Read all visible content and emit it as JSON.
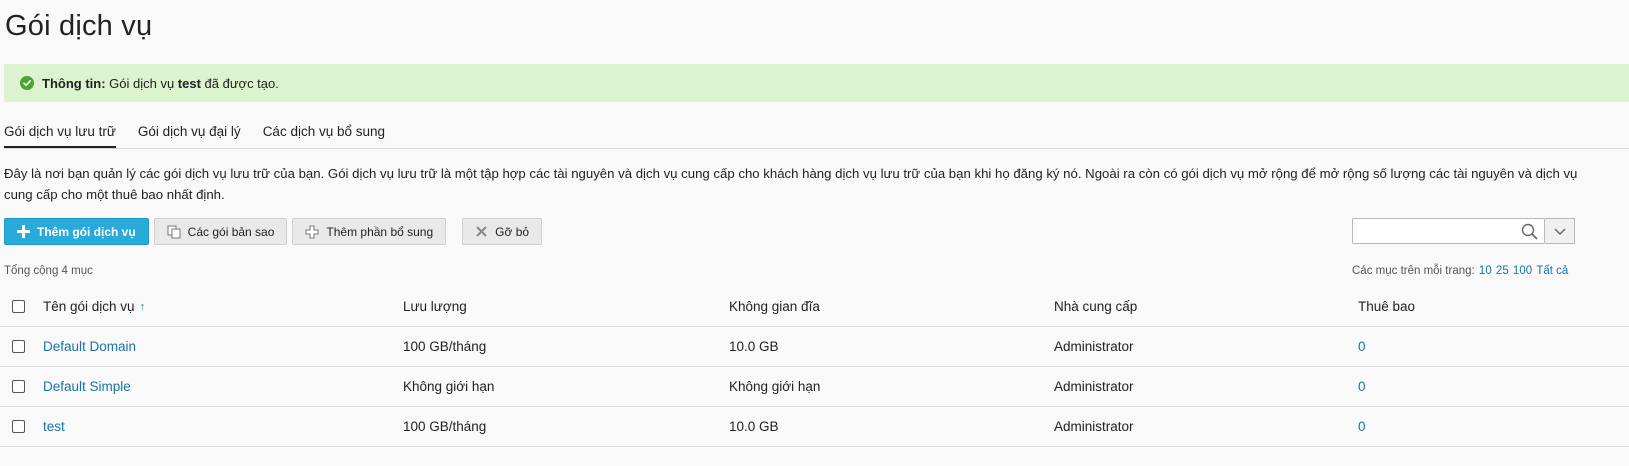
{
  "page": {
    "title": "Gói dịch vụ"
  },
  "alert": {
    "label": "Thông tin:",
    "text_before": " Gói dịch vụ ",
    "bold_name": "test",
    "text_after": " đã được tạo.",
    "icon": "check-circle-icon",
    "color": "#dcf3cf"
  },
  "tabs": [
    {
      "label": "Gói dịch vụ lưu trữ",
      "active": true
    },
    {
      "label": "Gói dịch vụ đại lý",
      "active": false
    },
    {
      "label": "Các dịch vụ bổ sung",
      "active": false
    }
  ],
  "hint": "Đây là nơi bạn quản lý các gói dịch vụ lưu trữ của bạn. Gói dịch vụ lưu trữ là một tập hợp các tài nguyên và dịch vụ cung cấp cho khách hàng dịch vụ lưu trữ của bạn khi họ đăng ký nó. Ngoài ra còn có gói dịch vụ mở rộng để mở rộng số lượng các tài nguyên và dịch vụ cung cấp cho một thuê bao nhất định.",
  "toolbar": {
    "add_label": "Thêm gói dịch vụ",
    "copies_label": "Các gói bản sao",
    "addon_label": "Thêm phần bổ sung",
    "remove_label": "Gỡ bỏ",
    "accent_color": "#28aadb"
  },
  "search": {
    "value": "",
    "placeholder": ""
  },
  "list": {
    "total": "Tổng cộng 4 mục",
    "per_page_label": "Các mục trên mỗi trang:",
    "per_page_options": [
      "10",
      "25",
      "100",
      "Tất cả"
    ]
  },
  "table": {
    "headers": {
      "name": "Tên gói dịch vụ",
      "sort_indicator": "↑",
      "traffic": "Lưu lượng",
      "disk": "Không gian đĩa",
      "provider": "Nhà cung cấp",
      "subscriptions": "Thuê bao"
    },
    "rows": [
      {
        "name": "Default Domain",
        "traffic": "100 GB/tháng",
        "disk": "10.0 GB",
        "provider": "Administrator",
        "subscriptions": "0"
      },
      {
        "name": "Default Simple",
        "traffic": "Không giới hạn",
        "disk": "Không giới hạn",
        "provider": "Administrator",
        "subscriptions": "0"
      },
      {
        "name": "test",
        "traffic": "100 GB/tháng",
        "disk": "10.0 GB",
        "provider": "Administrator",
        "subscriptions": "0"
      }
    ]
  }
}
